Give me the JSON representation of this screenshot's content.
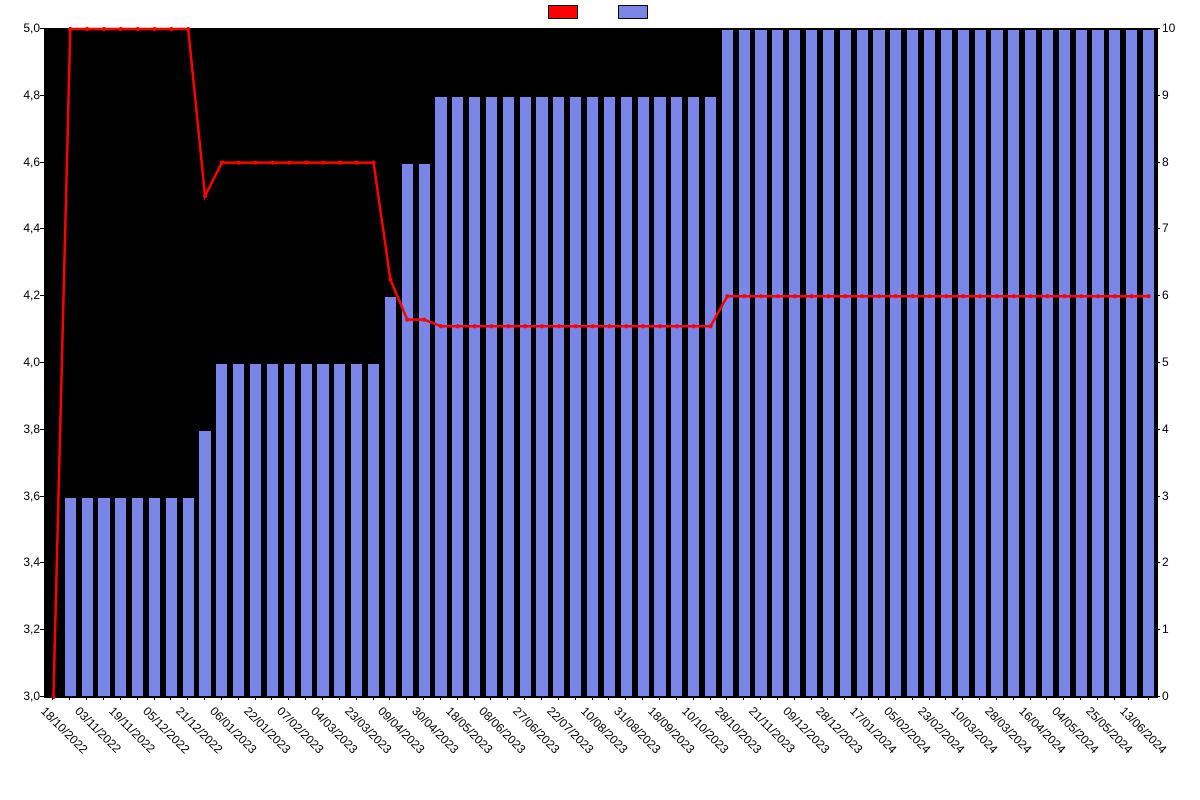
{
  "legend": {
    "series_line_label": "",
    "series_bar_label": ""
  },
  "axes": {
    "left": {
      "min": 3.0,
      "max": 5.0,
      "ticks": [
        "3,0",
        "3,2",
        "3,4",
        "3,6",
        "3,8",
        "4,0",
        "4,2",
        "4,4",
        "4,6",
        "4,8",
        "5,0"
      ]
    },
    "right": {
      "min": 0,
      "max": 10,
      "ticks": [
        "0",
        "1",
        "2",
        "3",
        "4",
        "5",
        "6",
        "7",
        "8",
        "9",
        "10"
      ]
    }
  },
  "chart_data": {
    "type": "bar",
    "title": "",
    "xlabel": "",
    "ylabel": "",
    "ylim_left": [
      3.0,
      5.0
    ],
    "ylim_right": [
      0,
      10
    ],
    "categories": [
      "18/10/2022",
      "",
      "03/11/2022",
      "",
      "19/11/2022",
      "",
      "05/12/2022",
      "",
      "21/12/2022",
      "",
      "06/01/2023",
      "",
      "22/01/2023",
      "",
      "07/02/2023",
      "",
      "04/03/2023",
      "",
      "23/03/2023",
      "",
      "09/04/2023",
      "",
      "30/04/2023",
      "",
      "18/05/2023",
      "",
      "08/06/2023",
      "",
      "27/06/2023",
      "",
      "22/07/2023",
      "",
      "10/08/2023",
      "",
      "31/08/2023",
      "",
      "18/09/2023",
      "",
      "10/10/2023",
      "",
      "28/10/2023",
      "",
      "21/11/2023",
      "",
      "09/12/2023",
      "",
      "28/12/2023",
      "",
      "17/01/2024",
      "",
      "05/02/2024",
      "",
      "23/02/2024",
      "",
      "10/03/2024",
      "",
      "28/03/2024",
      "",
      "16/04/2024",
      "",
      "04/05/2024",
      "",
      "25/05/2024",
      "",
      "13/06/2024",
      ""
    ],
    "x_ticks_shown": [
      "18/10/2022",
      "03/11/2022",
      "19/11/2022",
      "05/12/2022",
      "21/12/2022",
      "06/01/2023",
      "22/01/2023",
      "07/02/2023",
      "04/03/2023",
      "23/03/2023",
      "09/04/2023",
      "30/04/2023",
      "18/05/2023",
      "08/06/2023",
      "27/06/2023",
      "22/07/2023",
      "10/08/2023",
      "31/08/2023",
      "18/09/2023",
      "10/10/2023",
      "28/10/2023",
      "21/11/2023",
      "09/12/2023",
      "28/12/2023",
      "17/01/2024",
      "05/02/2024",
      "23/02/2024",
      "10/03/2024",
      "28/03/2024",
      "16/04/2024",
      "04/05/2024",
      "25/05/2024",
      "13/06/2024"
    ],
    "series": [
      {
        "name": "bar",
        "axis": "right",
        "color": "#7a85e8",
        "values": [
          0,
          3,
          3,
          3,
          3,
          3,
          3,
          3,
          3,
          4,
          5,
          5,
          5,
          5,
          5,
          5,
          5,
          5,
          5,
          5,
          6,
          8,
          8,
          9,
          9,
          9,
          9,
          9,
          9,
          9,
          9,
          9,
          9,
          9,
          9,
          9,
          9,
          9,
          9,
          9,
          10,
          10,
          10,
          10,
          10,
          10,
          10,
          10,
          10,
          10,
          10,
          10,
          10,
          10,
          10,
          10,
          10,
          10,
          10,
          10,
          10,
          10,
          10,
          10,
          10,
          10
        ]
      },
      {
        "name": "line",
        "axis": "left",
        "color": "#ff0000",
        "values": [
          3.0,
          5.0,
          5.0,
          5.0,
          5.0,
          5.0,
          5.0,
          5.0,
          5.0,
          4.5,
          4.6,
          4.6,
          4.6,
          4.6,
          4.6,
          4.6,
          4.6,
          4.6,
          4.6,
          4.6,
          4.25,
          4.13,
          4.13,
          4.11,
          4.11,
          4.11,
          4.11,
          4.11,
          4.11,
          4.11,
          4.11,
          4.11,
          4.11,
          4.11,
          4.11,
          4.11,
          4.11,
          4.11,
          4.11,
          4.11,
          4.2,
          4.2,
          4.2,
          4.2,
          4.2,
          4.2,
          4.2,
          4.2,
          4.2,
          4.2,
          4.2,
          4.2,
          4.2,
          4.2,
          4.2,
          4.2,
          4.2,
          4.2,
          4.2,
          4.2,
          4.2,
          4.2,
          4.2,
          4.2,
          4.2,
          4.2
        ]
      }
    ]
  }
}
